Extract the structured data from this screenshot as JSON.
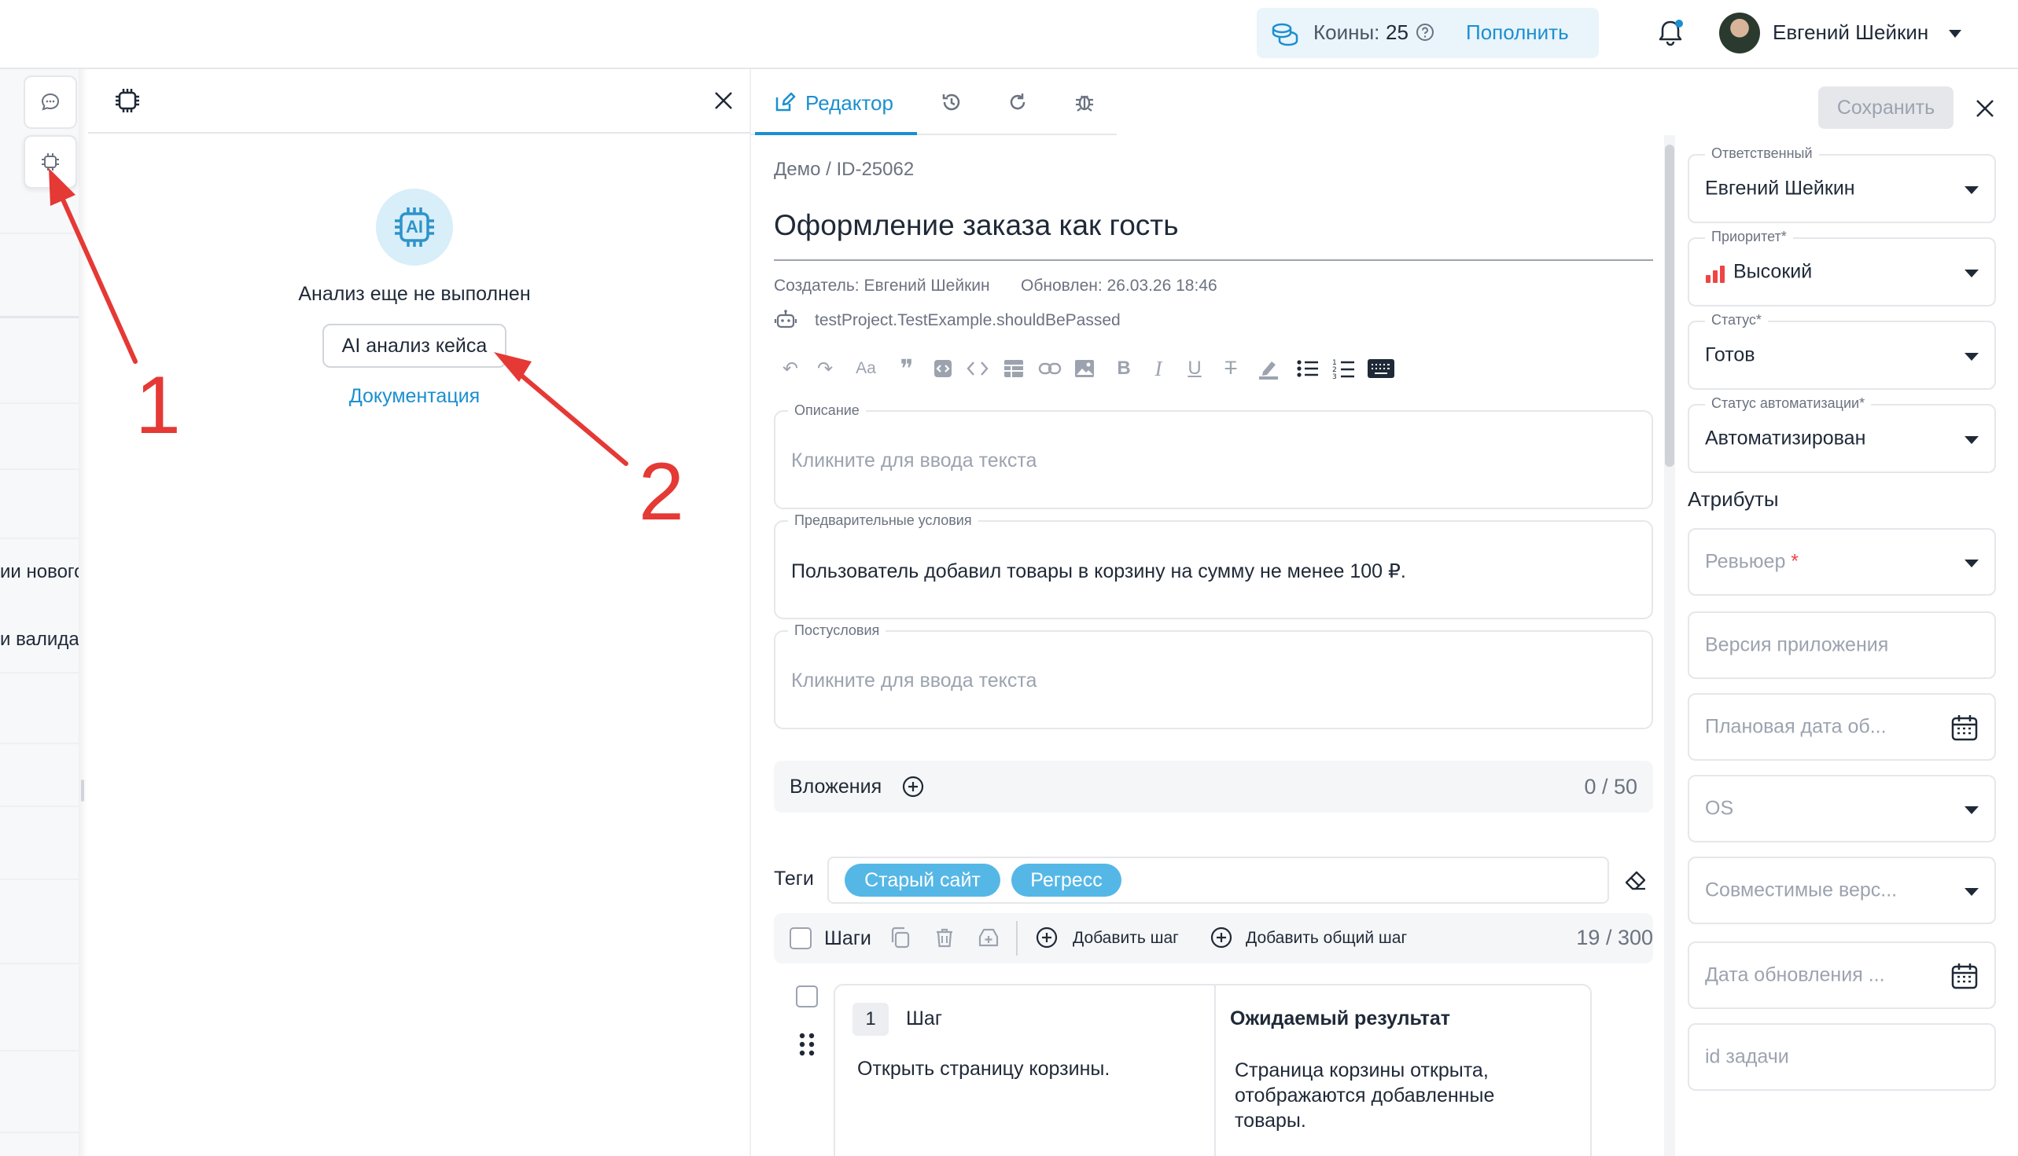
{
  "header": {
    "coins_label": "Коины:",
    "coins_value": "25",
    "topup_label": "Пополнить",
    "user_name": "Евгений Шейкин"
  },
  "background_list": {
    "snippet_1": "ии нового",
    "snippet_2": "и валида"
  },
  "ai_panel": {
    "status_text": "Анализ еще не выполнен",
    "analyze_button": "AI анализ кейса",
    "docs_link": "Документация",
    "badge_text": "AI"
  },
  "annotations": {
    "arrow_1": "1",
    "arrow_2": "2"
  },
  "editor": {
    "tabs": [
      {
        "label": "Редактор"
      }
    ],
    "save_button": "Сохранить",
    "breadcrumb": "Демо / ID-25062",
    "title": "Оформление заказа как гость",
    "creator": "Создатель: Евгений Шейкин",
    "updated": "Обновлен: 26.03.26 18:46",
    "automation_path": "testProject.TestExample.shouldBePassed",
    "description": {
      "label": "Описание",
      "placeholder": "Кликните для ввода текста"
    },
    "preconditions": {
      "label": "Предварительные условия",
      "value": "Пользователь добавил товары в корзину на сумму не менее 100 ₽."
    },
    "postconditions": {
      "label": "Постусловия",
      "placeholder": "Кликните для ввода текста"
    },
    "attachments": {
      "label": "Вложения",
      "count": "0 / 50"
    },
    "tags": {
      "label": "Теги",
      "items": [
        "Старый сайт",
        "Регресс"
      ]
    },
    "steps": {
      "label": "Шаги",
      "add_step": "Добавить шаг",
      "add_shared_step": "Добавить общий шаг",
      "count": "19 / 300",
      "step_col": "Шаг",
      "expected_col": "Ожидаемый результат",
      "rows": [
        {
          "num": "1",
          "action": "Открыть страницу корзины.",
          "expected": "Страница корзины открыта, отображаются добавленные товары."
        }
      ]
    }
  },
  "sidebar": {
    "responsible": {
      "label": "Ответственный",
      "value": "Евгений Шейкин"
    },
    "priority": {
      "label": "Приоритет*",
      "value": "Высокий"
    },
    "status": {
      "label": "Статус*",
      "value": "Готов"
    },
    "automation_status": {
      "label": "Статус автоматизации*",
      "value": "Автоматизирован"
    },
    "attributes_heading": "Атрибуты",
    "reviewer": {
      "placeholder": "Ревьюер",
      "required_mark": "*"
    },
    "app_version": {
      "placeholder": "Версия приложения"
    },
    "planned_date": {
      "placeholder": "Плановая дата об..."
    },
    "os": {
      "placeholder": "OS"
    },
    "compatible_versions": {
      "placeholder": "Совместимые верс..."
    },
    "update_date": {
      "placeholder": "Дата обновления ..."
    },
    "task_id": {
      "placeholder": "id задачи"
    }
  },
  "colors": {
    "accent": "#1b8fd0",
    "tag_bg": "#55b7e6",
    "priority_high": "#ef4444",
    "annotation_red": "#e53935"
  }
}
